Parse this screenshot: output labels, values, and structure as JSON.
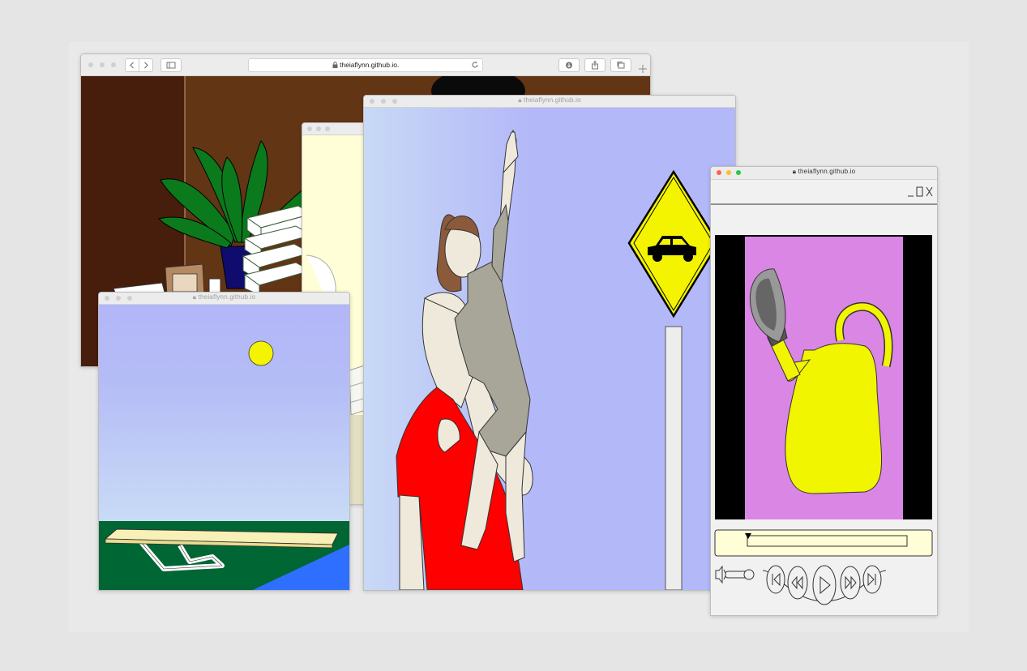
{
  "windows": {
    "main": {
      "url": "theiaflynn.github.io."
    },
    "cream": {
      "url": ""
    },
    "diving": {
      "url": "theiaflynn.github.io"
    },
    "child": {
      "url": "theiaflynn.github.io"
    },
    "player": {
      "url": "theiaflynn.github.io"
    }
  },
  "icons": {
    "back": "chevron-left-icon",
    "forward": "chevron-right-icon",
    "sidebar": "sidebar-icon",
    "lock": "lock-icon",
    "reload": "reload-icon",
    "download": "download-icon",
    "share": "share-icon",
    "tabs": "tabs-icon",
    "new_tab": "plus-icon",
    "volume": "speaker-icon",
    "skip_start": "skip-to-start-icon",
    "rewind": "rewind-icon",
    "play": "play-icon",
    "fast_forward": "fast-forward-icon",
    "skip_end": "skip-to-end-icon"
  },
  "player": {
    "progress": 0.0
  },
  "colors": {
    "sign_yellow": "#f4f400",
    "shirt_red": "#ff0000",
    "sky_blue": "#b3b8f8",
    "video_pink": "#da86e4",
    "can_yellow": "#f2f500",
    "room_brown": "#623515",
    "grass_green": "#006633",
    "pool_blue": "#2f6fff"
  }
}
